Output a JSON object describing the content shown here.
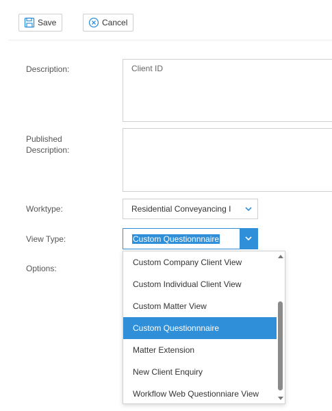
{
  "toolbar": {
    "save_label": "Save",
    "cancel_label": "Cancel"
  },
  "form": {
    "description_label": "Description:",
    "description_value": "Client ID",
    "published_label_line1": "Published",
    "published_label_line2": "Description:",
    "published_value": "",
    "worktype_label": "Worktype:",
    "worktype_value": "Residential Conveyancing I",
    "viewtype_label": "View Type:",
    "viewtype_value": "Custom Questionnnaire",
    "options_label": "Options:"
  },
  "dropdown": {
    "options": [
      "Custom Company Client View",
      "Custom Individual Client View",
      "Custom Matter View",
      "Custom Questionnnaire",
      "Matter Extension",
      "New Client Enquiry",
      "Workflow Web Questionniare View"
    ],
    "selected_index": 3
  },
  "colors": {
    "accent": "#2f8fd8",
    "border": "#cfcfcf"
  },
  "icons": {
    "save": "save-icon",
    "cancel": "cancel-icon",
    "chevron": "chevron-down-icon"
  }
}
